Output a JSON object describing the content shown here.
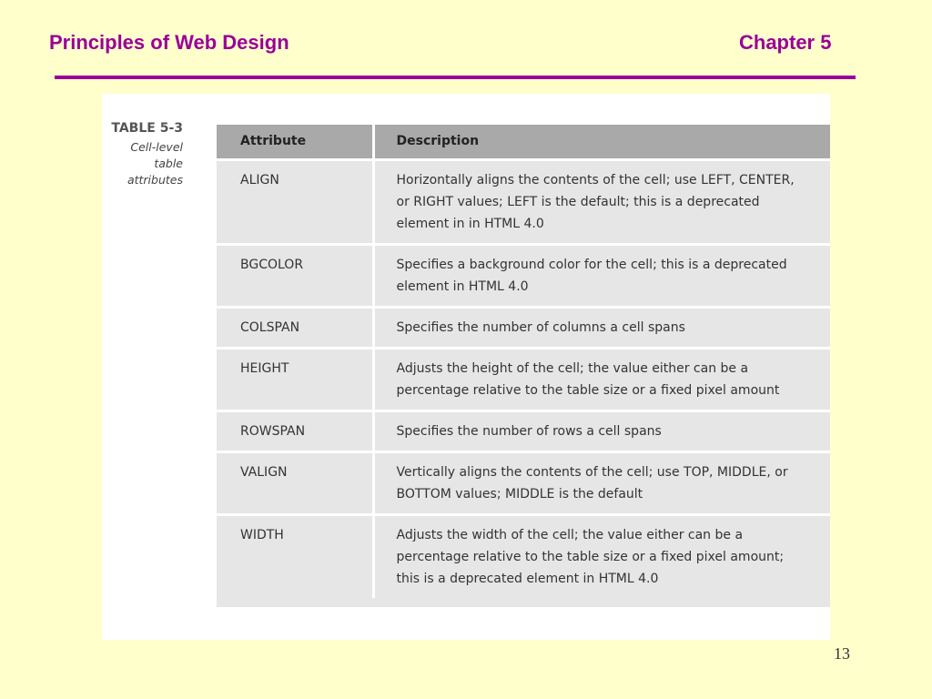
{
  "slide": {
    "title": "Principles of Web Design",
    "chapter": "Chapter 5",
    "page_number": "13",
    "accent_color": "#990099",
    "background_color": "#ffffcc"
  },
  "figure": {
    "table_number": "TABLE 5-3",
    "caption": "Cell-level table attributes",
    "headers": [
      "Attribute",
      "Description"
    ],
    "rows": [
      {
        "attribute": "ALIGN",
        "description": "Horizontally aligns the contents of the cell; use LEFT, CENTER, or RIGHT values; LEFT is the default; this is a deprecated element in in HTML 4.0"
      },
      {
        "attribute": "BGCOLOR",
        "description": "Specifies a background color for the cell; this is a deprecated element in HTML 4.0"
      },
      {
        "attribute": "COLSPAN",
        "description": "Specifies the number of columns a cell spans"
      },
      {
        "attribute": "HEIGHT",
        "description": "Adjusts the height of the cell; the value either can be a percentage relative to the table size or a fixed pixel amount"
      },
      {
        "attribute": "ROWSPAN",
        "description": "Specifies the number of rows a cell spans"
      },
      {
        "attribute": "VALIGN",
        "description": "Vertically aligns the contents of the cell; use TOP, MIDDLE, or BOTTOM values; MIDDLE is the default"
      },
      {
        "attribute": "WIDTH",
        "description": "Adjusts the width of the cell; the value either can be a percentage relative to the table size or a fixed pixel amount; this is a deprecated element in HTML 4.0"
      }
    ]
  }
}
